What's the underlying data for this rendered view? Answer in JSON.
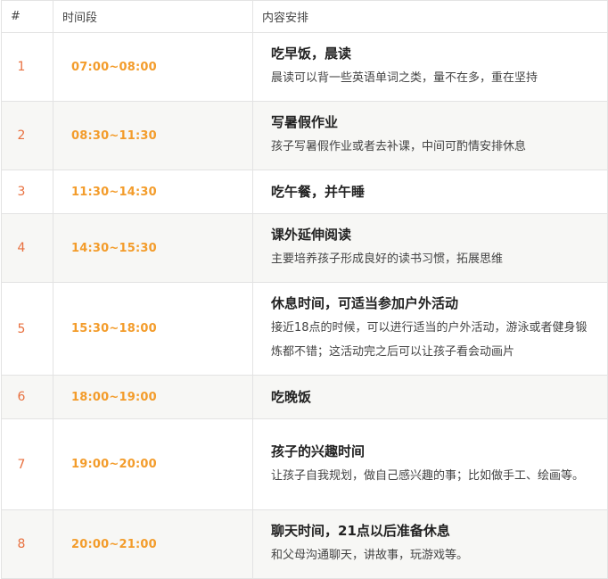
{
  "header": {
    "num": "#",
    "time": "时间段",
    "content": "内容安排"
  },
  "rows": [
    {
      "num": "1",
      "time": "07:00~08:00",
      "title": "吃早饭，晨读",
      "desc": "晨读可以背一些英语单词之类，量不在多，重在坚持"
    },
    {
      "num": "2",
      "time": "08:30~11:30",
      "title": "写暑假作业",
      "desc": "孩子写暑假作业或者去补课，中间可酌情安排休息"
    },
    {
      "num": "3",
      "time": "11:30~14:30",
      "title": "吃午餐，并午睡",
      "desc": ""
    },
    {
      "num": "4",
      "time": "14:30~15:30",
      "title": "课外延伸阅读",
      "desc": "主要培养孩子形成良好的读书习惯，拓展思维"
    },
    {
      "num": "5",
      "time": "15:30~18:00",
      "title": "休息时间，可适当参加户外活动",
      "desc": "接近18点的时候，可以进行适当的户外活动，游泳或者健身锻炼都不错；这活动完之后可以让孩子看会动画片"
    },
    {
      "num": "6",
      "time": "18:00~19:00",
      "title": "吃晚饭",
      "desc": ""
    },
    {
      "num": "7",
      "time": "19:00~20:00",
      "title": "孩子的兴趣时间",
      "desc": "让孩子自我规划，做自己感兴趣的事；比如做手工、绘画等。"
    },
    {
      "num": "8",
      "time": "20:00~21:00",
      "title": "聊天时间，21点以后准备休息",
      "desc": "和父母沟通聊天，讲故事，玩游戏等。"
    }
  ]
}
